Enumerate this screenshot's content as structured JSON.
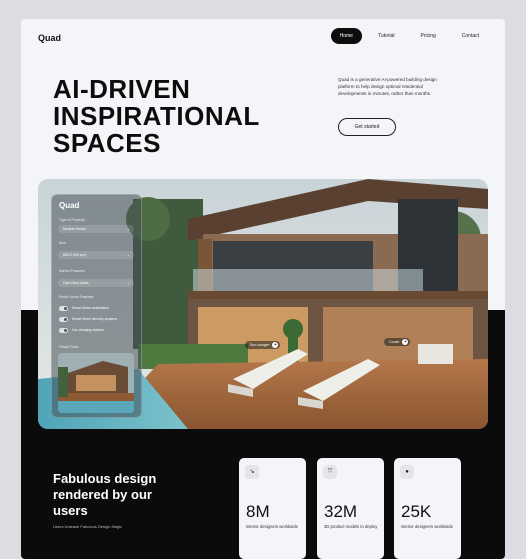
{
  "nav": {
    "logo": "Quad",
    "links": [
      "Home",
      "Tutorial",
      "Pricing",
      "Contact"
    ],
    "active": "Home"
  },
  "hero": {
    "title_lines": [
      "AI-DRIVEN",
      "INSPIRATIONAL",
      "SPACES"
    ],
    "description": "Quad is a generative AI-powered building design platform to help design optimal residential developments in minutes, rather than months.",
    "cta_label": "Get started"
  },
  "panel": {
    "title": "Quad",
    "type_label": "Type of Property",
    "type_value": "Modern House",
    "size_label": "Size",
    "size_value": "800-2,400 sq ft",
    "interior_label": "Interior Features",
    "interior_value": "Open floor plans",
    "smart_label": "Smart Home Features",
    "smart_items": [
      "Smart Home automation",
      "Smart Home security systems",
      "Car charging stations"
    ],
    "tours_label": "Virtual Tours"
  },
  "hotspots": {
    "sun_lounger": "Sun lounger",
    "couch": "Couch"
  },
  "bottom": {
    "title_lines": [
      "Fabulous design",
      "rendered by our",
      "users"
    ],
    "subtitle": "Users Unleash Fabulous Design Magic",
    "stats": [
      {
        "icon": "arrow-icon",
        "glyph": "↘",
        "value": "8M",
        "label": "interior designers worldwide"
      },
      {
        "icon": "expand-icon",
        "glyph": "⤧",
        "value": "32M",
        "label": "3D product models to deploy"
      },
      {
        "icon": "dot-icon",
        "glyph": "●",
        "value": "25K",
        "label": "interior designers worldwide"
      }
    ]
  },
  "colors": {
    "accent": "#0d0d0d",
    "background": "#f4f5f8"
  }
}
